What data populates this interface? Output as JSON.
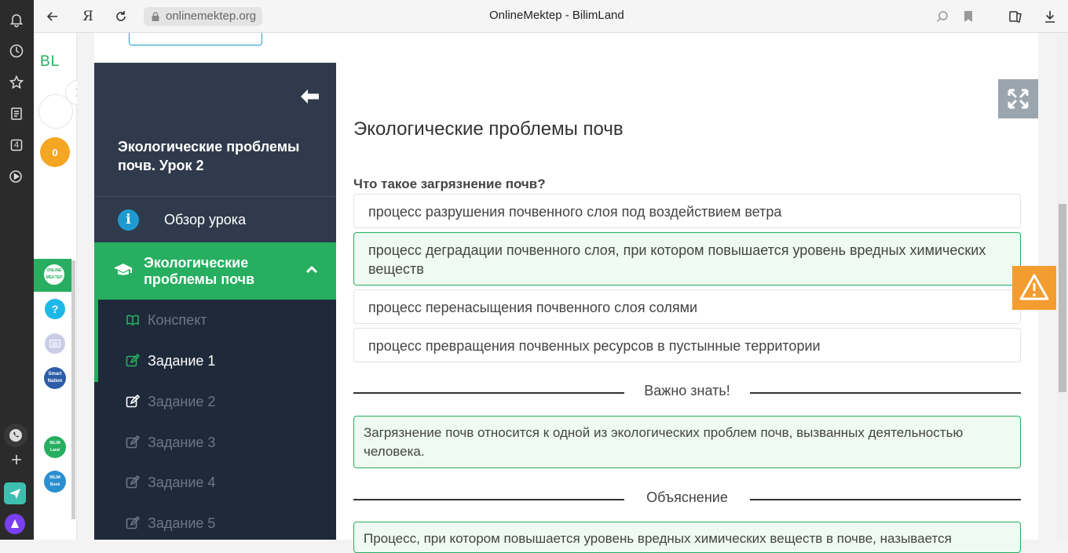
{
  "browser": {
    "url": "onlinemektep.org",
    "tab_title": "OnlineMektep - BilimLand",
    "rail_badge": "4"
  },
  "site_rail": {
    "logo": "BL",
    "coin_count": "0",
    "help": "?"
  },
  "sidebar": {
    "title": "Экологические проблемы почв. Урок 2",
    "overview": "Обзор урока",
    "section": "Экологические проблемы почв",
    "items": [
      {
        "label": "Конспект"
      },
      {
        "label": "Задание 1"
      },
      {
        "label": "Задание 2"
      },
      {
        "label": "Задание 3"
      },
      {
        "label": "Задание 4"
      },
      {
        "label": "Задание 5"
      }
    ]
  },
  "main": {
    "heading": "Экологические проблемы почв",
    "question": "Что такое загрязнение почв?",
    "options": [
      {
        "text": "процесс разрушения почвенного слоя под воздействием ветра",
        "selected": false
      },
      {
        "text": "процесс деградации почвенного слоя, при котором повышается уровень вредных химических веществ",
        "selected": true
      },
      {
        "text": "процесс перенасыщения почвенного слоя солями",
        "selected": false
      },
      {
        "text": "процесс превращения почвенных ресурсов в пустынные территории",
        "selected": false
      }
    ],
    "important_label": "Важно знать!",
    "important_text": "Загрязнение почв относится к одной из экологических проблем почв, вызванных деятельностью человека.",
    "explanation_label": "Объяснение",
    "explanation_text": "Процесс, при котором повышается уровень вредных химических веществ в почве, называется"
  },
  "colors": {
    "green": "#27ae60",
    "sidebar_dark": "#2f3b4c",
    "warning": "#f39c2f"
  }
}
